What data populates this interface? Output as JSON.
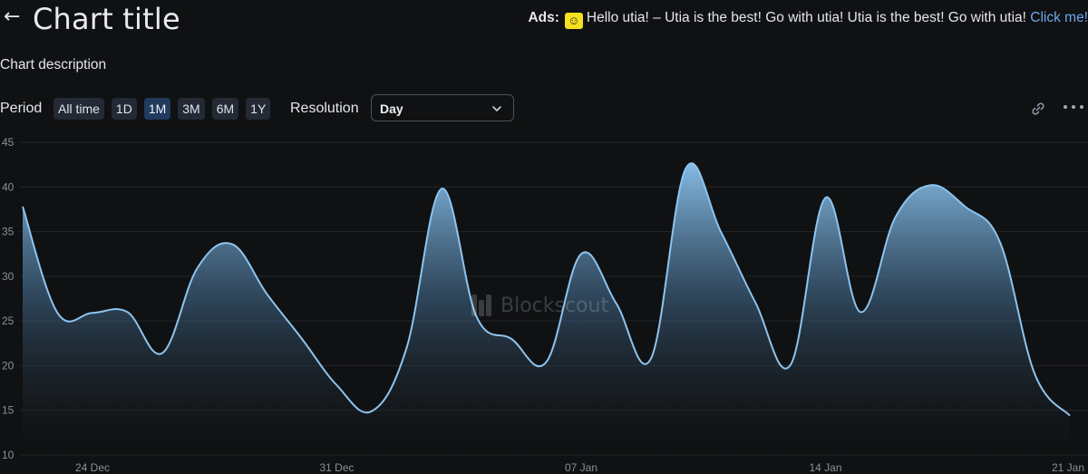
{
  "header": {
    "title": "Chart title",
    "back_icon": "arrow-left-icon"
  },
  "ads": {
    "label": "Ads:",
    "icon": "utia-icon",
    "text": "Hello utia! – Utia is the best! Go with utia! Utia is the best! Go with utia! ",
    "link": "Click me!"
  },
  "description": "Chart description",
  "controls": {
    "period_label": "Period",
    "periods": [
      "All time",
      "1D",
      "1M",
      "3M",
      "6M",
      "1Y"
    ],
    "active_period": "1M",
    "resolution_label": "Resolution",
    "resolution_value": "Day",
    "link_icon": "link-icon",
    "more_icon": "more-options-icon"
  },
  "watermark": "Blockscout",
  "colors": {
    "line": "#8cc4ef",
    "background": "#101112",
    "active_period": "#213a5e"
  },
  "chart_data": {
    "type": "area",
    "title": "Chart title",
    "xlabel": "",
    "ylabel": "",
    "x": [
      "22 Dec",
      "23 Dec",
      "24 Dec",
      "25 Dec",
      "26 Dec",
      "27 Dec",
      "28 Dec",
      "29 Dec",
      "30 Dec",
      "31 Dec",
      "01 Jan",
      "02 Jan",
      "03 Jan",
      "04 Jan",
      "05 Jan",
      "06 Jan",
      "07 Jan",
      "08 Jan",
      "09 Jan",
      "10 Jan",
      "11 Jan",
      "12 Jan",
      "13 Jan",
      "14 Jan",
      "15 Jan",
      "16 Jan",
      "17 Jan",
      "18 Jan",
      "19 Jan",
      "20 Jan",
      "21 Jan"
    ],
    "series": [
      {
        "values": [
          37.8,
          25.9,
          25.9,
          26.0,
          21.4,
          30.9,
          33.6,
          28.0,
          23.0,
          17.8,
          14.9,
          22.0,
          39.8,
          25.5,
          23.0,
          20.4,
          32.5,
          27.0,
          20.8,
          42.1,
          35.0,
          27.0,
          20.1,
          38.8,
          26.0,
          36.6,
          40.2,
          37.8,
          33.8,
          19.0,
          14.4
        ]
      }
    ],
    "x_ticks": [
      "24 Dec",
      "31 Dec",
      "07 Jan",
      "14 Jan",
      "21 Jan"
    ],
    "y_ticks": [
      10,
      15,
      20,
      25,
      30,
      35,
      40,
      45
    ],
    "ylim": [
      10,
      45
    ],
    "grid": true,
    "legend": "none"
  }
}
